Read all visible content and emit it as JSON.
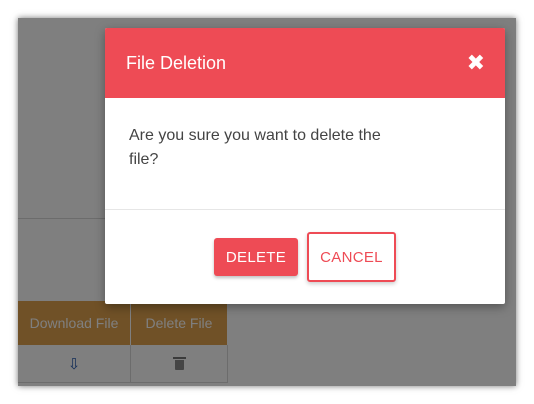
{
  "table": {
    "headers": [
      "Download File",
      "Delete File"
    ],
    "row": {
      "download_icon": "download-arrow-icon",
      "delete_icon": "trash-icon"
    }
  },
  "modal": {
    "title": "File Deletion",
    "close_icon": "close-icon",
    "close_glyph": "✖",
    "message": "Are you sure you want to delete the file?",
    "delete_label": "DELETE",
    "cancel_label": "CANCEL"
  },
  "colors": {
    "accent": "#ee4b55",
    "table_header": "#e0a34e",
    "icon_blue": "#2a5db0"
  }
}
